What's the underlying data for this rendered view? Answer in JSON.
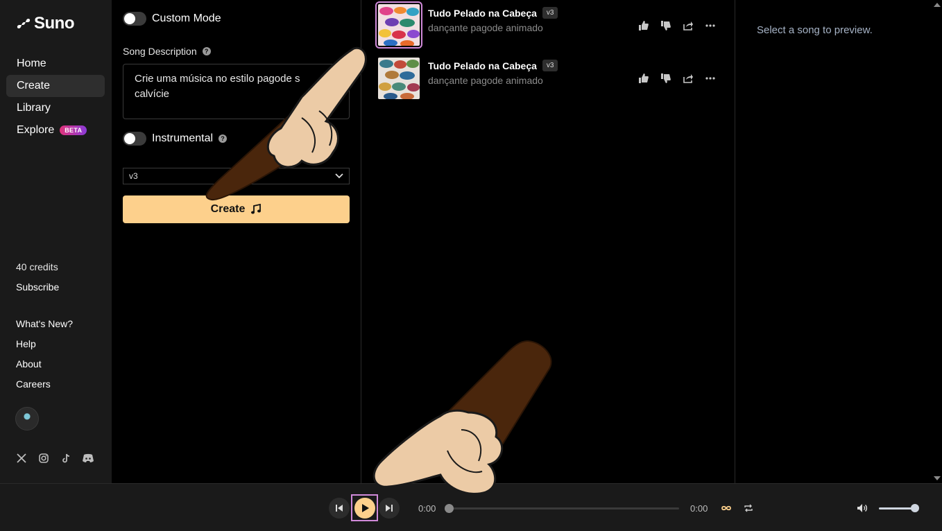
{
  "brand": {
    "name": "Suno"
  },
  "nav": {
    "items": [
      {
        "label": "Home"
      },
      {
        "label": "Create",
        "active": true
      },
      {
        "label": "Library"
      },
      {
        "label": "Explore",
        "badge": "BETA"
      }
    ]
  },
  "account": {
    "credits": "40 credits",
    "subscribe": "Subscribe"
  },
  "footer_links": [
    "What's New?",
    "Help",
    "About",
    "Careers"
  ],
  "socials": [
    "x-icon",
    "instagram-icon",
    "tiktok-icon",
    "discord-icon"
  ],
  "create": {
    "custom_mode_label": "Custom Mode",
    "song_description_label": "Song Description",
    "song_description_value": "Crie uma música no estilo pagode s\ncalvície",
    "instrumental_label": "Instrumental",
    "model_value": "v3",
    "create_label": "Create"
  },
  "songs": [
    {
      "title": "Tudo Pelado na Cabeça",
      "version": "v3",
      "tags": "dançante pagode animado",
      "selected": true
    },
    {
      "title": "Tudo Pelado na Cabeça",
      "version": "v3",
      "tags": "dançante pagode animado",
      "selected": false
    }
  ],
  "preview": {
    "placeholder": "Select a song to preview."
  },
  "player": {
    "current_time": "0:00",
    "duration": "0:00",
    "progress": 0,
    "volume": 0.9
  },
  "colors": {
    "accent": "#fdd08c",
    "highlight": "#d08ad9",
    "beta_from": "#e0337a",
    "beta_to": "#8a3bd9"
  }
}
